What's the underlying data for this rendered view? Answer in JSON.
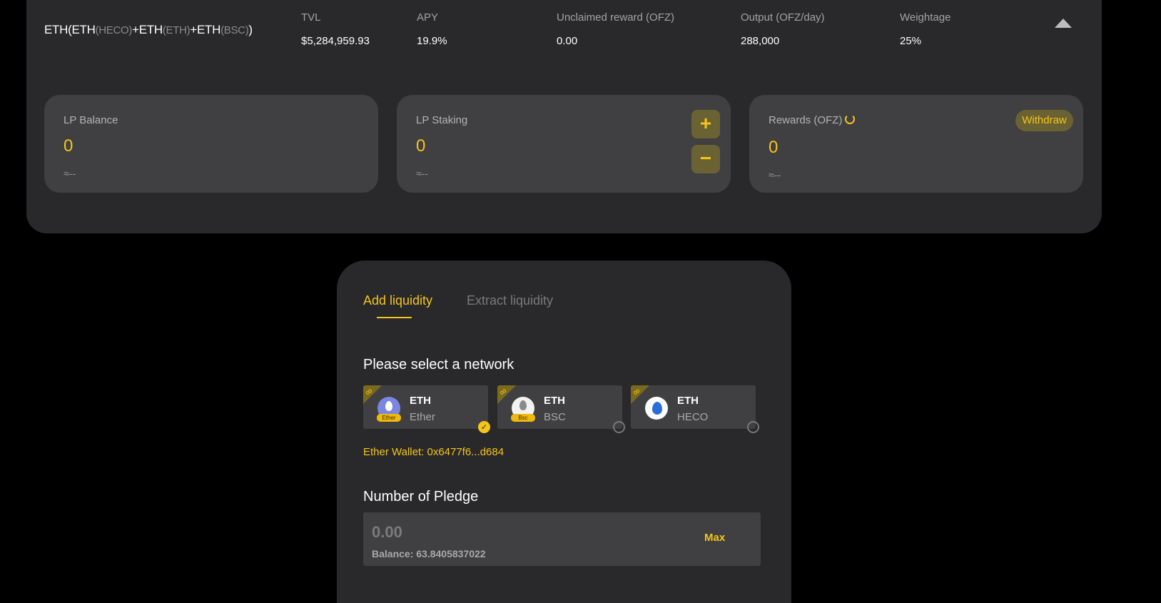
{
  "pool": {
    "name_parts": [
      {
        "t": "ETH(ETH",
        "s": false
      },
      {
        "t": "(HECO)",
        "s": true
      },
      {
        "t": "+ETH",
        "s": false
      },
      {
        "t": "(ETH)",
        "s": true
      },
      {
        "t": "+ETH",
        "s": false
      },
      {
        "t": "(BSC)",
        "s": true
      },
      {
        "t": ")",
        "s": false
      }
    ],
    "stats": [
      {
        "label": "TVL",
        "value": "$5,284,959.93"
      },
      {
        "label": "APY",
        "value": "19.9%"
      },
      {
        "label": "Unclaimed reward (OFZ)",
        "value": "0.00"
      },
      {
        "label": "Output (OFZ/day)",
        "value": "288,000"
      },
      {
        "label": "Weightage",
        "value": "25%"
      }
    ],
    "lp_balance": {
      "label": "LP Balance",
      "value": "0",
      "approx": "≈--"
    },
    "lp_staking": {
      "label": "LP Staking",
      "value": "0",
      "approx": "≈--",
      "plus": "+",
      "minus": "−"
    },
    "rewards": {
      "label": "Rewards (OFZ)",
      "value": "0",
      "approx": "≈--",
      "withdraw": "Withdraw"
    }
  },
  "liquidity": {
    "tabs": [
      {
        "label": "Add liquidity",
        "active": true
      },
      {
        "label": "Extract liquidity",
        "active": false
      }
    ],
    "network_title": "Please select a network",
    "networks": [
      {
        "name": "ETH",
        "sub": "Ether",
        "tag": "Ether",
        "selected": true,
        "icon": "ether-coin-icon"
      },
      {
        "name": "ETH",
        "sub": "BSC",
        "tag": "Bsc",
        "selected": false,
        "icon": "bsc-coin-icon"
      },
      {
        "name": "ETH",
        "sub": "HECO",
        "tag": "",
        "selected": false,
        "icon": "heco-coin-icon"
      }
    ],
    "wallet": "Ether Wallet: 0x6477f6...d684",
    "pledge_title": "Number of Pledge",
    "pledge_placeholder": "0.00",
    "balance": "Balance: 63.8405837022",
    "max_label": "Max"
  },
  "colors": {
    "accent": "#f5c518",
    "card": "#29292c",
    "box": "#404043"
  }
}
